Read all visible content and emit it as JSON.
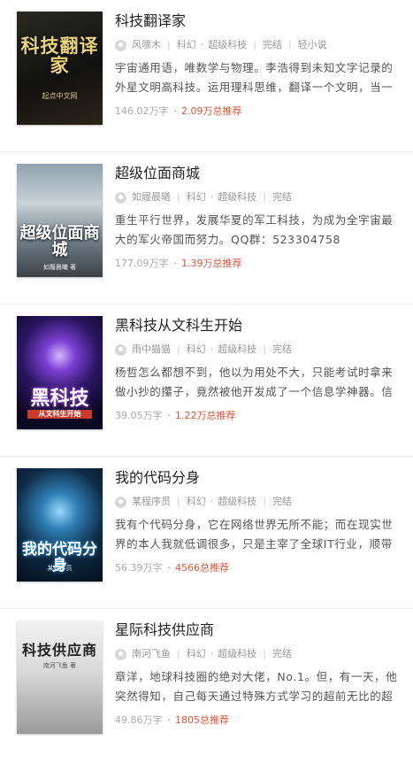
{
  "books": [
    {
      "title": "科技翻译家",
      "author": "风嘌木",
      "category": "科幻",
      "subcategory": "超级科技",
      "status": "完结",
      "tag": "轻小说",
      "description": "宇宙通用语，唯数学与物理。李浩得到未知文字记录的外星文明高科技。运用理科思维，翻译一个文明，当一",
      "words": "146.02万字",
      "recommend": "2.09万总推荐",
      "cover_text": "科技翻译家",
      "cover_sub": "起点中文网"
    },
    {
      "title": "超级位面商城",
      "author": "如履晨曦",
      "category": "科幻",
      "subcategory": "超级科技",
      "status": "完结",
      "description": "重生平行世界，发展华夏的军工科技，为成为全宇宙最大的军火帝国而努力。QQ群：523304758",
      "words": "177.09万字",
      "recommend": "1.39万总推荐",
      "cover_text": "超级位面商城",
      "cover_sub": "如履晨曦 著"
    },
    {
      "title": "黑科技从文科生开始",
      "author": "雨中猫猫",
      "category": "科幻",
      "subcategory": "超级科技",
      "status": "完结",
      "description": "杨哲怎么都想不到，他以为用处不大，只能考试时拿来做小抄的攥子，竟然被他开发成了一个信息学神器。信",
      "words": "39.05万字",
      "recommend": "1.22万总推荐",
      "cover_text": "黑科技",
      "cover_sub": "从文科生开始"
    },
    {
      "title": "我的代码分身",
      "author": "某程序员",
      "category": "科幻",
      "subcategory": "超级科技",
      "status": "完结",
      "description": "我有个代码分身，它在网络世界无所不能；而在现实世界的本人我就低调很多，只是主宰了全球IT行业，顺带",
      "words": "56.39万字",
      "recommend": "4566总推荐",
      "cover_text": "我的代码分身",
      "cover_sub": "某程序员"
    },
    {
      "title": "星际科技供应商",
      "author": "南河飞鱼",
      "category": "科幻",
      "subcategory": "超级科技",
      "status": "完结",
      "description": "章洋，地球科技圈的绝对大佬，No.1。但，有一天，他突然得知，自己每天通过特殊方式学习的超前无比的超",
      "words": "49.86万字",
      "recommend": "1805总推荐",
      "cover_text": "科技供应商",
      "cover_sub": "南河飞鱼 著"
    }
  ]
}
